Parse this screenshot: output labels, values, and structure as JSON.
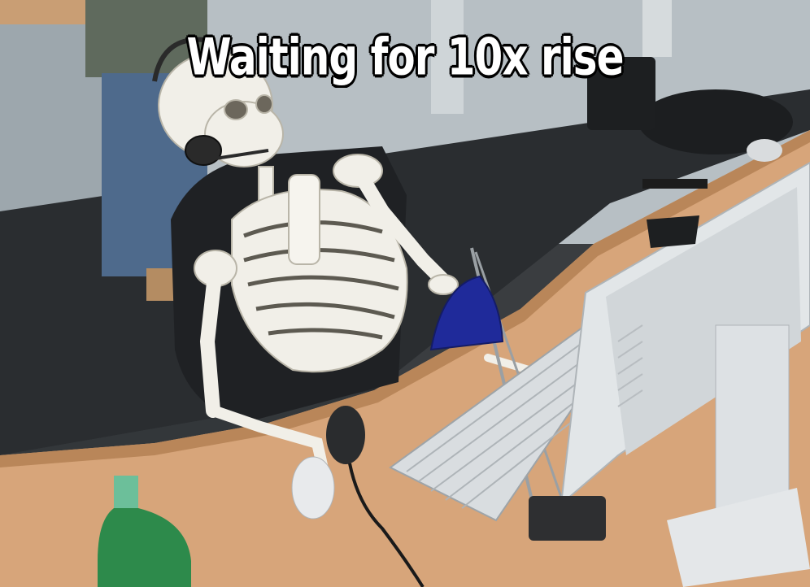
{
  "meme": {
    "caption": "Waiting for 10x rise"
  },
  "colors": {
    "wall": "#b9c0c4",
    "carpet": "#2b2e31",
    "desk": "#d9a77c",
    "monitor": "#dfe3e6",
    "lamp": "#1f2a9a",
    "bottle": "#2d8a4b",
    "skeleton": "#f1efe8"
  }
}
